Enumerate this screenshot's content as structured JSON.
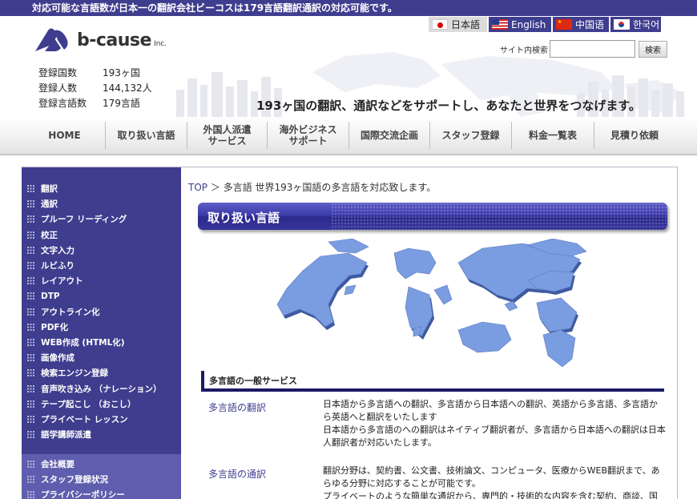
{
  "topbar": {
    "text": "対応可能な言語数が日本一の翻訳会社ビーコスは179言語翻訳通訳の対応可能です。"
  },
  "logo": {
    "word": "b-cause",
    "inc": "Inc."
  },
  "languages": [
    {
      "label": "日本語",
      "flag": "japan-flag-icon"
    },
    {
      "label": "English",
      "flag": "us-flag-icon"
    },
    {
      "label": "中国语",
      "flag": "china-flag-icon"
    },
    {
      "label": "한국어",
      "flag": "korea-flag-icon"
    }
  ],
  "search": {
    "label": "サイト内検索",
    "button": "検索",
    "value": ""
  },
  "stats": [
    {
      "label": "登録国数",
      "value": "193ヶ国"
    },
    {
      "label": "登録人数",
      "value": "144,132人"
    },
    {
      "label": "登録言語数",
      "value": "179言語"
    }
  ],
  "tagline": "193ヶ国の翻訳、通訳などをサポートし、あなたと世界をつなげます。",
  "nav": [
    {
      "line1": "HOME",
      "line2": ""
    },
    {
      "line1": "取り扱い言語",
      "line2": ""
    },
    {
      "line1": "外国人派遣",
      "line2": "サービス"
    },
    {
      "line1": "海外ビジネス",
      "line2": "サポート"
    },
    {
      "line1": "国際交流企画",
      "line2": ""
    },
    {
      "line1": "スタッフ登録",
      "line2": ""
    },
    {
      "line1": "料金一覧表",
      "line2": ""
    },
    {
      "line1": "見積り依頼",
      "line2": ""
    }
  ],
  "sidebar": {
    "items": [
      "翻訳",
      "通訳",
      "プルーフ リーディング",
      "校正",
      "文字入力",
      "ルビふり",
      "レイアウト",
      "DTP",
      "アウトライン化",
      "PDF化",
      "WEB作成 (HTML化)",
      "画像作成",
      "検索エンジン登録",
      "音声吹き込み （ナレーション）",
      "テープ起こし （おこし）",
      "プライベート レッスン",
      "語学講師派遣"
    ],
    "sub_items": [
      "会社概要",
      "スタッフ登録状況",
      "プライバシーポリシー"
    ]
  },
  "breadcrumb": {
    "top": "TOP",
    "separator": "＞",
    "current": "多言語 世界193ヶ国語の多言語を対応致します。"
  },
  "page_heading": "取り扱い言語",
  "section_title": "多言語の一般サービス",
  "services": [
    {
      "name": "多言語の翻訳",
      "desc": "日本語から多言語への翻訳、多言語から日本語への翻訳、英語から多言語、多言語から英語へと翻訳をいたします\n日本語から多言語のへの翻訳はネイティブ翻訳者が、多言語から日本語への翻訳は日本人翻訳者が対応いたします。"
    },
    {
      "name": "多言語の通訳",
      "desc": "翻訳分野は、契約書、公文書、技術論文、コンピュータ、医療からWEB翻訳まで、あらゆる分野に対応することが可能です。\nプライベートのような簡単な通訳から、専門的・技術的な内容を含む契約、商談、国"
    }
  ],
  "colors": {
    "brand": "#3f3d8e",
    "brand_light": "#5f5dad",
    "map": "#7a9ce0"
  }
}
